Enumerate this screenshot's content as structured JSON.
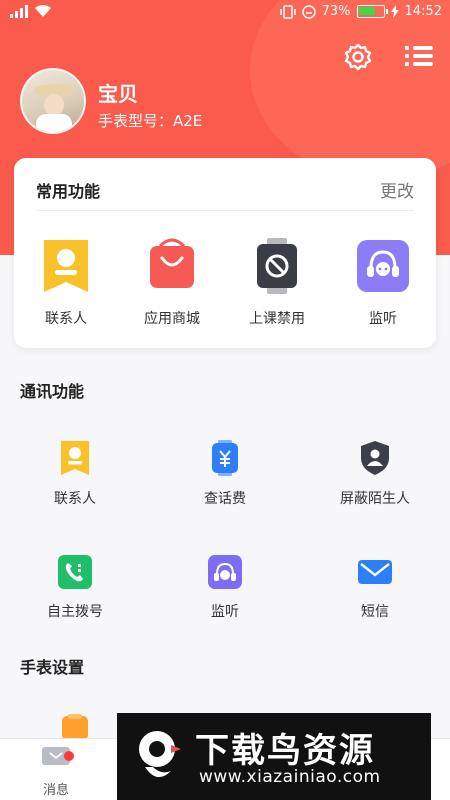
{
  "statusbar": {
    "battery": "73%",
    "time": "14:52",
    "battery_level": 0.73
  },
  "profile": {
    "name": "宝贝",
    "model": "手表型号：A2E"
  },
  "common": {
    "title": "常用功能",
    "edit": "更改",
    "items": [
      {
        "label": "联系人",
        "icon": "contacts-icon"
      },
      {
        "label": "应用商城",
        "icon": "app-store-icon"
      },
      {
        "label": "上课禁用",
        "icon": "class-disable-icon"
      },
      {
        "label": "监听",
        "icon": "monitor-icon"
      }
    ]
  },
  "comm": {
    "title": "通讯功能",
    "items": [
      {
        "label": "联系人",
        "icon": "contacts-icon"
      },
      {
        "label": "查话费",
        "icon": "bill-icon"
      },
      {
        "label": "屏蔽陌生人",
        "icon": "block-stranger-icon"
      },
      {
        "label": "自主拨号",
        "icon": "dial-icon"
      },
      {
        "label": "监听",
        "icon": "monitor-icon"
      },
      {
        "label": "短信",
        "icon": "sms-icon"
      }
    ]
  },
  "watch": {
    "title": "手表设置"
  },
  "nav": {
    "items": [
      {
        "label": "消息",
        "icon": "message-icon"
      }
    ]
  },
  "watermark": {
    "title": "下载鸟资源",
    "url": "www.xiazainiao.com"
  },
  "colors": {
    "header": "#fa5b4c",
    "accent_yellow": "#f9c22b",
    "accent_purple": "#7d6cf4",
    "green": "#1fbf6a",
    "blue": "#2d7ff9"
  }
}
